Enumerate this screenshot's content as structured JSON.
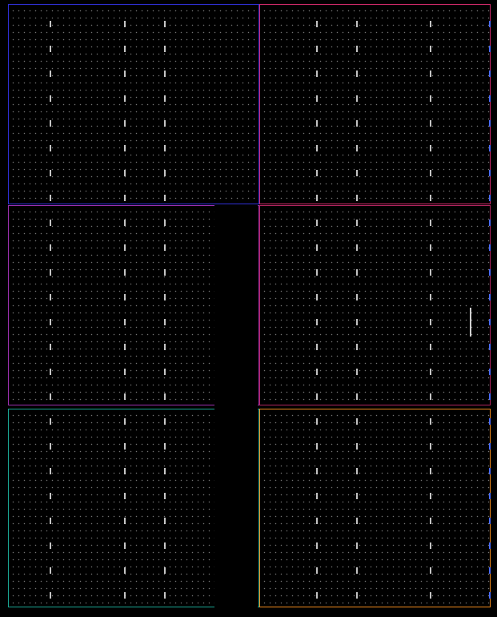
{
  "screen": {
    "background": "#000000",
    "panels": [
      {
        "id": "top-left",
        "border": "#2f2fd6"
      },
      {
        "id": "top-right",
        "border": "#d02a6a"
      },
      {
        "id": "middle-left",
        "border": "#9b2fae"
      },
      {
        "id": "middle-right",
        "border": "#b0245e"
      },
      {
        "id": "bottom-left",
        "border": "#1aa592"
      },
      {
        "id": "bottom-right",
        "border": "#f08a1c"
      }
    ]
  }
}
